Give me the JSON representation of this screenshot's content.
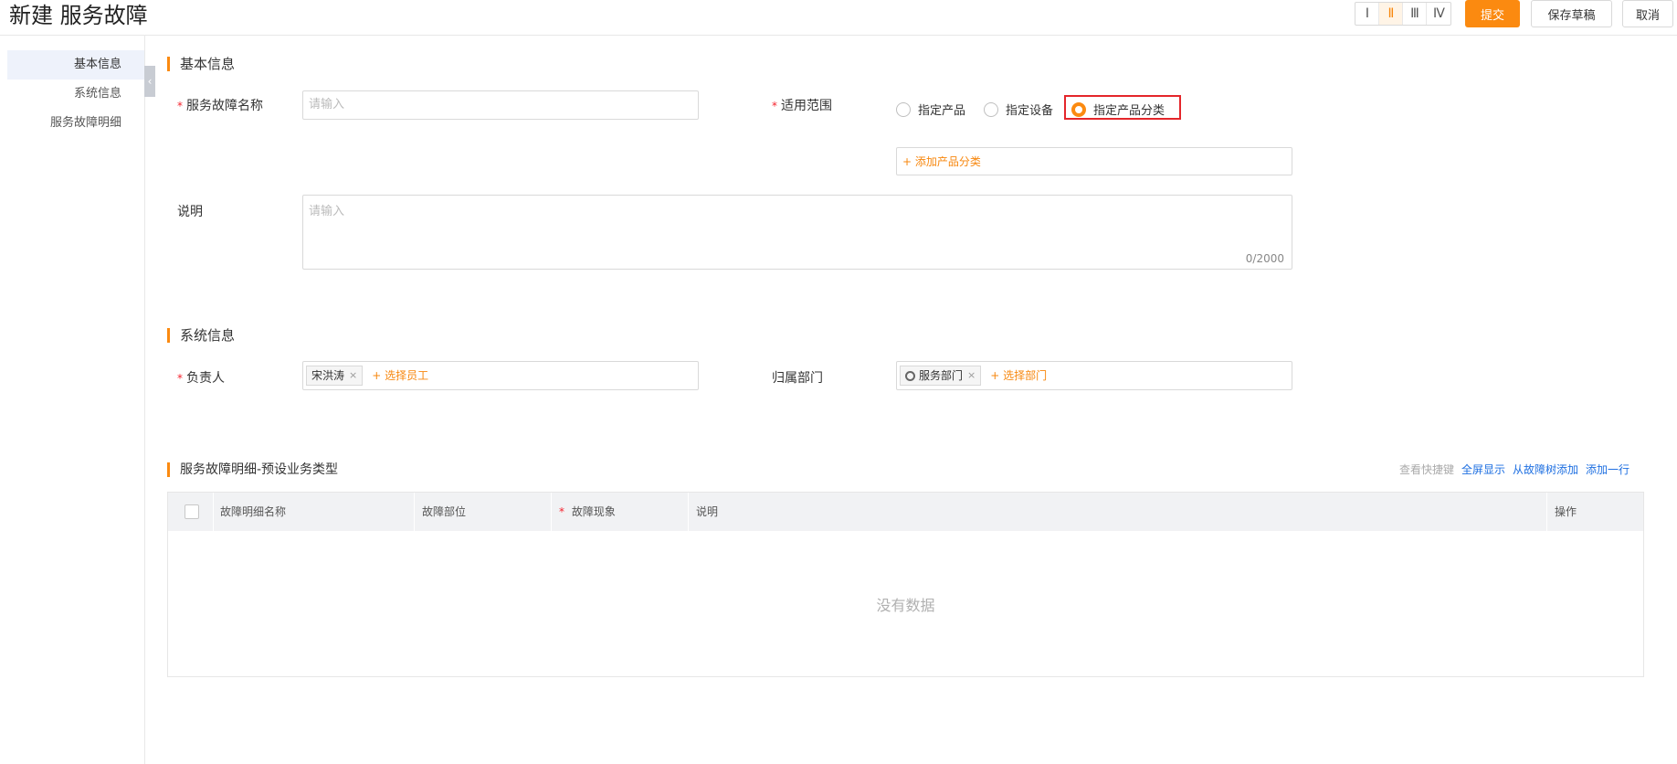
{
  "header": {
    "title": "新建 服务故障",
    "column_options": [
      "Ⅰ",
      "Ⅱ",
      "Ⅲ",
      "Ⅳ"
    ],
    "column_active_index": 1,
    "submit_label": "提交",
    "save_draft_label": "保存草稿",
    "cancel_label": "取消"
  },
  "sidebar": {
    "items": [
      {
        "label": "基本信息",
        "active": true
      },
      {
        "label": "系统信息",
        "active": false
      },
      {
        "label": "服务故障明细",
        "active": false
      }
    ],
    "collapse_icon": "chevron-left-icon"
  },
  "basic": {
    "section_title": "基本信息",
    "name_label": "服务故障名称",
    "name_placeholder": "请输入",
    "scope_label": "适用范围",
    "scope_options": [
      {
        "label": "指定产品",
        "checked": false
      },
      {
        "label": "指定设备",
        "checked": false
      },
      {
        "label": "指定产品分类",
        "checked": true
      }
    ],
    "add_category": "+ 添加产品分类",
    "desc_label": "说明",
    "desc_placeholder": "请输入",
    "desc_counter": "0/2000"
  },
  "system": {
    "section_title": "系统信息",
    "owner_label": "负责人",
    "owner_tag": "宋洪涛",
    "owner_add": "+ 选择员工",
    "dept_label": "归属部门",
    "dept_tag": "服务部门",
    "dept_add": "+ 选择部门",
    "tag_close": "×"
  },
  "detail": {
    "section_title": "服务故障明细-预设业务类型",
    "links": {
      "shortcut": "查看快捷键",
      "fullscreen": "全屏显示",
      "from_tree": "从故障树添加",
      "add_row": "添加一行"
    },
    "columns": [
      "故障明细名称",
      "故障部位",
      "故障现象",
      "说明",
      "操作"
    ],
    "empty_text": "没有数据"
  },
  "colors": {
    "accent": "#fb8a10",
    "link": "#1e6fe1",
    "required": "#f5222d",
    "highlight_box": "#e4262b"
  }
}
